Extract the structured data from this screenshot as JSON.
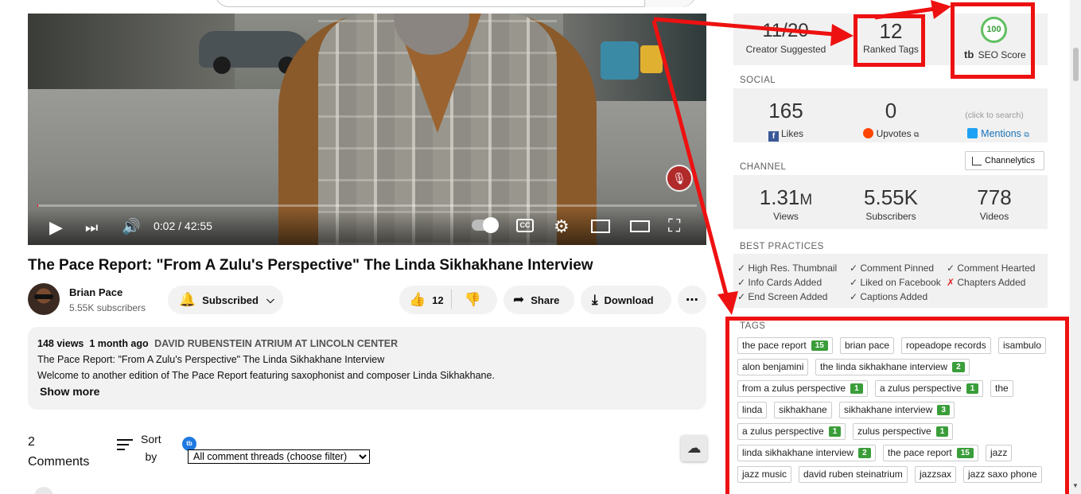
{
  "video": {
    "time": "0:02 / 42:55",
    "progress_pct": 0.08,
    "title": "The Pace Report: \"From A Zulu's Perspective\" The Linda Sikhakhane Interview"
  },
  "channel": {
    "name": "Brian Pace",
    "subscribers": "5.55K subscribers",
    "subscribed_label": "Subscribed"
  },
  "actions": {
    "like_count": "12",
    "share_label": "Share",
    "download_label": "Download"
  },
  "description": {
    "views": "148 views",
    "age": "1 month ago",
    "location": "DAVID RUBENSTEIN ATRIUM AT LINCOLN CENTER",
    "line1": "The Pace Report: \"From A Zulu's Perspective\" The Linda Sikhakhane Interview",
    "line2": "Welcome to another edition of The Pace Report featuring saxophonist and composer Linda Sikhakhane.",
    "show_more": "Show more"
  },
  "comments": {
    "count": "2",
    "count_label": "Comments",
    "sort_line1": "Sort",
    "sort_line2": "by",
    "filter_selected": "All comment threads (choose filter)"
  },
  "seo": {
    "creator_suggested_value": "11/20",
    "creator_suggested_label": "Creator Suggested",
    "ranked_tags_value": "12",
    "ranked_tags_label": "Ranked Tags",
    "seo_score": "100",
    "seo_score_label": "SEO Score",
    "brand_mark": "tb"
  },
  "social": {
    "heading": "SOCIAL",
    "likes_value": "165",
    "likes_label": "Likes",
    "upvotes_value": "0",
    "upvotes_label": "Upvotes",
    "click_hint": "(click to search)",
    "mentions_label": "Mentions"
  },
  "channel_stats": {
    "heading": "CHANNEL",
    "channelytics_label": "Channelytics",
    "views_value": "1.31",
    "views_unit": "M",
    "views_label": "Views",
    "subs_value": "5.55K",
    "subs_label": "Subscribers",
    "videos_value": "778",
    "videos_label": "Videos"
  },
  "best_practices": {
    "heading": "BEST PRACTICES",
    "items": [
      {
        "label": "High Res. Thumbnail",
        "ok": true
      },
      {
        "label": "Comment Pinned",
        "ok": true
      },
      {
        "label": "Comment Hearted",
        "ok": true
      },
      {
        "label": "Info Cards Added",
        "ok": true
      },
      {
        "label": "Liked on Facebook",
        "ok": true
      },
      {
        "label": "Chapters Added",
        "ok": false
      },
      {
        "label": "End Screen Added",
        "ok": true
      },
      {
        "label": "Captions Added",
        "ok": true
      }
    ]
  },
  "tags": {
    "heading": "TAGS",
    "items": [
      {
        "label": "the pace report",
        "rank": "15"
      },
      {
        "label": "brian pace",
        "rank": ""
      },
      {
        "label": "ropeadope records",
        "rank": ""
      },
      {
        "label": "isambulo",
        "rank": ""
      },
      {
        "label": "alon benjamini",
        "rank": ""
      },
      {
        "label": "the linda sikhakhane interview",
        "rank": "2"
      },
      {
        "label": "from a zulus perspective",
        "rank": "1"
      },
      {
        "label": "a zulus perspective",
        "rank": "1"
      },
      {
        "label": "the",
        "rank": ""
      },
      {
        "label": "linda",
        "rank": ""
      },
      {
        "label": "sikhakhane",
        "rank": ""
      },
      {
        "label": "sikhakhane interview",
        "rank": "3"
      },
      {
        "label": "a zulus perspective",
        "rank": "1"
      },
      {
        "label": "zulus perspective",
        "rank": "1"
      },
      {
        "label": "linda sikhakhane interview",
        "rank": "2"
      },
      {
        "label": "the pace report",
        "rank": "15"
      },
      {
        "label": "jazz",
        "rank": ""
      },
      {
        "label": "jazz music",
        "rank": ""
      },
      {
        "label": "david ruben steinatrium",
        "rank": ""
      },
      {
        "label": "jazzsax",
        "rank": ""
      },
      {
        "label": "jazz saxo phone",
        "rank": ""
      }
    ]
  },
  "colors": {
    "annotation_red": "#ee1111",
    "rank_green": "#3a9d3a",
    "panel_bg": "#f1f1f1"
  }
}
